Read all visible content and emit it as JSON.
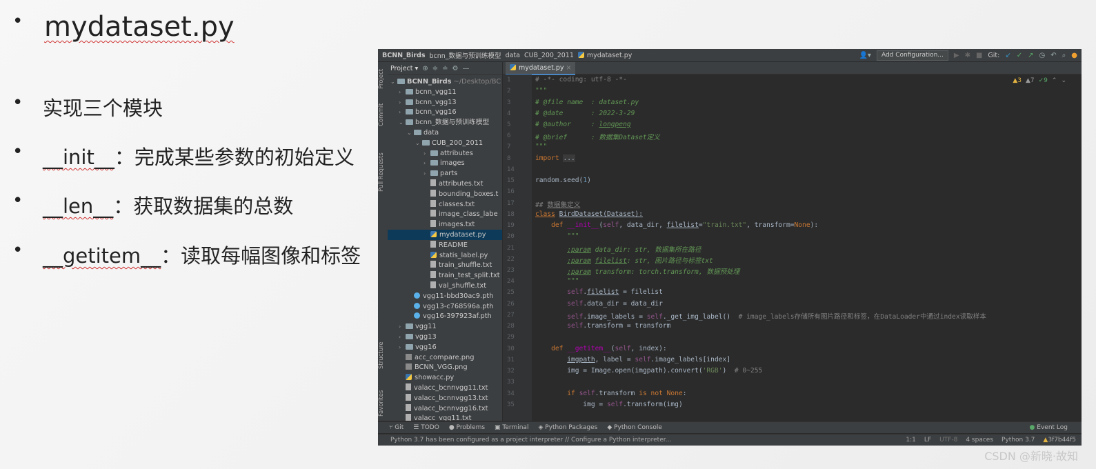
{
  "slide": {
    "title": "mydataset.py",
    "bullets": [
      {
        "text": "实现三个模块"
      },
      {
        "code": "__init__",
        "text": "：完成某些参数的初始定义"
      },
      {
        "code": "__len__",
        "text": "：获取数据集的总数"
      },
      {
        "code": "__getitem__",
        "text": "：读取每幅图像和标签"
      }
    ],
    "watermark": "CSDN @新晓·故知"
  },
  "ide": {
    "breadcrumbs": [
      "BCNN_Birds",
      "bcnn_数据与预训练模型",
      "data",
      "CUB_200_2011",
      "mydataset.py"
    ],
    "toolbar": {
      "add_configuration": "Add Configuration...",
      "git_label": "Git:"
    },
    "side_tabs": {
      "project": "Project",
      "commit": "Commit",
      "pull_requests": "Pull Requests",
      "structure": "Structure",
      "favorites": "Favorites"
    },
    "project_panel": {
      "header": "Project",
      "tree": [
        {
          "label": "BCNN_Birds",
          "sub": "~/Desktop/BC",
          "indent": 0,
          "kind": "folder",
          "arrow": "v"
        },
        {
          "label": "bcnn_vgg11",
          "indent": 1,
          "kind": "folder",
          "arrow": ">"
        },
        {
          "label": "bcnn_vgg13",
          "indent": 1,
          "kind": "folder",
          "arrow": ">"
        },
        {
          "label": "bcnn_vgg16",
          "indent": 1,
          "kind": "folder",
          "arrow": ">"
        },
        {
          "label": "bcnn_数据与预训练模型",
          "indent": 1,
          "kind": "folder",
          "arrow": "v"
        },
        {
          "label": "data",
          "indent": 2,
          "kind": "folder",
          "arrow": "v"
        },
        {
          "label": "CUB_200_2011",
          "indent": 3,
          "kind": "folder",
          "arrow": "v"
        },
        {
          "label": "attributes",
          "indent": 4,
          "kind": "folder",
          "arrow": ">"
        },
        {
          "label": "images",
          "indent": 4,
          "kind": "folder",
          "arrow": ">"
        },
        {
          "label": "parts",
          "indent": 4,
          "kind": "folder",
          "arrow": ">"
        },
        {
          "label": "attributes.txt",
          "indent": 4,
          "kind": "file",
          "arrow": ""
        },
        {
          "label": "bounding_boxes.t",
          "indent": 4,
          "kind": "file",
          "arrow": ""
        },
        {
          "label": "classes.txt",
          "indent": 4,
          "kind": "file",
          "arrow": ""
        },
        {
          "label": "image_class_labe",
          "indent": 4,
          "kind": "file",
          "arrow": ""
        },
        {
          "label": "images.txt",
          "indent": 4,
          "kind": "file",
          "arrow": ""
        },
        {
          "label": "mydataset.py",
          "indent": 4,
          "kind": "py",
          "arrow": "",
          "selected": true
        },
        {
          "label": "README",
          "indent": 4,
          "kind": "file",
          "arrow": ""
        },
        {
          "label": "statis_label.py",
          "indent": 4,
          "kind": "py",
          "arrow": ""
        },
        {
          "label": "train_shuffle.txt",
          "indent": 4,
          "kind": "file",
          "arrow": ""
        },
        {
          "label": "train_test_split.txt",
          "indent": 4,
          "kind": "file",
          "arrow": ""
        },
        {
          "label": "val_shuffle.txt",
          "indent": 4,
          "kind": "file",
          "arrow": ""
        },
        {
          "label": "vgg11-bbd30ac9.pth",
          "indent": 2,
          "kind": "pth",
          "arrow": ""
        },
        {
          "label": "vgg13-c768596a.pth",
          "indent": 2,
          "kind": "pth",
          "arrow": ""
        },
        {
          "label": "vgg16-397923af.pth",
          "indent": 2,
          "kind": "pth",
          "arrow": ""
        },
        {
          "label": "vgg11",
          "indent": 1,
          "kind": "folder",
          "arrow": ">"
        },
        {
          "label": "vgg13",
          "indent": 1,
          "kind": "folder",
          "arrow": ">"
        },
        {
          "label": "vgg16",
          "indent": 1,
          "kind": "folder",
          "arrow": ">"
        },
        {
          "label": "acc_compare.png",
          "indent": 1,
          "kind": "png",
          "arrow": ""
        },
        {
          "label": "BCNN_VGG.png",
          "indent": 1,
          "kind": "png",
          "arrow": ""
        },
        {
          "label": "showacc.py",
          "indent": 1,
          "kind": "py",
          "arrow": ""
        },
        {
          "label": "valacc_bcnnvgg11.txt",
          "indent": 1,
          "kind": "file",
          "arrow": ""
        },
        {
          "label": "valacc_bcnnvgg13.txt",
          "indent": 1,
          "kind": "file",
          "arrow": ""
        },
        {
          "label": "valacc_bcnnvgg16.txt",
          "indent": 1,
          "kind": "file",
          "arrow": ""
        },
        {
          "label": "valacc_vgg11.txt",
          "indent": 1,
          "kind": "file",
          "arrow": ""
        }
      ]
    },
    "editor": {
      "tab": "mydataset.py",
      "indicators": {
        "warnings": "3",
        "weak_warnings": "7",
        "ok": "9"
      },
      "line_numbers": [
        "1",
        "2",
        "3",
        "4",
        "5",
        "6",
        "7",
        "8",
        "14",
        "15",
        "16",
        "17",
        "18",
        "19",
        "20",
        "21",
        "22",
        "23",
        "24",
        "25",
        "26",
        "27",
        "28",
        "29",
        "30",
        "31",
        "32",
        "33",
        "34",
        "35"
      ]
    },
    "bottom_tabs": [
      "Git",
      "TODO",
      "Problems",
      "Terminal",
      "Python Packages",
      "Python Console"
    ],
    "event_log": "Event Log",
    "status": {
      "message": "Python 3.7 has been configured as a project interpreter // Configure a Python interpreter...",
      "position": "1:1",
      "line_sep": "LF",
      "encoding": "UTF-8",
      "indent": "4 spaces",
      "interpreter": "Python 3.7",
      "commit": "3f7b44f5"
    }
  }
}
